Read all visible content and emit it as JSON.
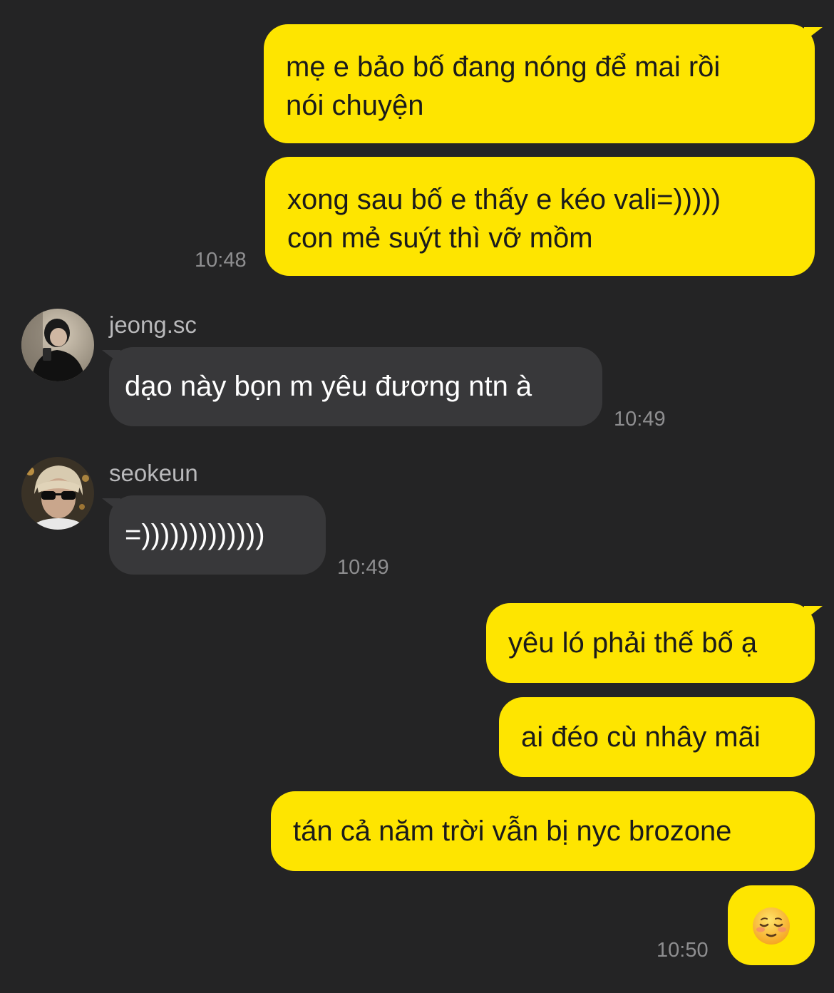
{
  "messages": [
    {
      "lines": [
        "mẹ e bảo bố đang nóng để mai rồi",
        "nói chuyện"
      ]
    },
    {
      "lines": [
        "xong sau bố e thấy e kéo vali=)))))",
        "con mẻ suýt thì vỡ mồm"
      ],
      "time": "10:48"
    },
    {
      "sender": "jeong.sc",
      "text": "dạo này bọn m yêu đương ntn à",
      "time": "10:49"
    },
    {
      "sender": "seokeun",
      "text": "=)))))))))))))",
      "time": "10:49"
    },
    {
      "text": "yêu ló phải thế bố ạ"
    },
    {
      "text": "ai đéo cù nhây mãi"
    },
    {
      "text": "tán cả năm trời vẫn bị nyc brozone"
    },
    {
      "emoji": "relieved-face-emoji",
      "time": "10:50"
    }
  ],
  "colors": {
    "background": "#242425",
    "outgoing_bubble": "#FEE500",
    "incoming_bubble": "#38383A",
    "timestamp": "#8e8e90",
    "sender_name": "#b9b9bb"
  }
}
